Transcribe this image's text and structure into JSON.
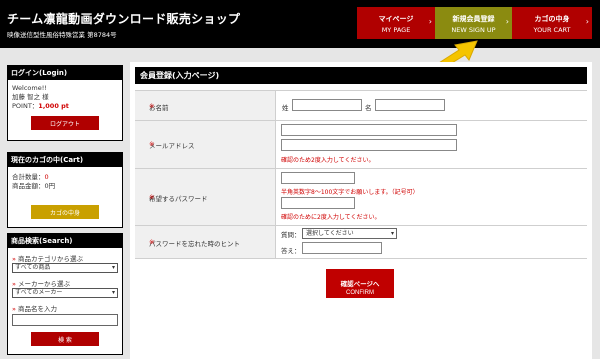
{
  "header": {
    "title": "チーム凛龍動画ダウンロード販売ショップ",
    "subtitle": "映像送信型性風俗特殊営業 第8784号",
    "nav": [
      {
        "label": "マイページ",
        "sub": "MY PAGE"
      },
      {
        "label": "新規会員登録",
        "sub": "NEW SIGN UP"
      },
      {
        "label": "カゴの中身",
        "sub": "YOUR CART"
      }
    ],
    "chevron": "›"
  },
  "sidebar": {
    "login": {
      "heading": "ログイン(Login)",
      "welcome": "Welcome!!",
      "user_name": "加藤 智之 様",
      "point_label": "POINT：",
      "point_value": "1,000 pt",
      "logout_button": "ログアウト"
    },
    "cart": {
      "heading": "現在のカゴの中(Cart)",
      "count_label": "合計数量：",
      "count_value": "0",
      "total_label": "商品金額：",
      "total_value": "0円",
      "cart_button": "カゴの中身"
    },
    "search": {
      "heading": "商品検索(Search)",
      "marker": "»",
      "category_label": "商品カテゴリから選ぶ",
      "category_value": "すべての商品",
      "maker_label": "メーカーから選ぶ",
      "maker_value": "すべてのメーカー",
      "name_label": "商品名を入力",
      "search_button": "検 索"
    }
  },
  "main": {
    "title": "会員登録(入力ページ)",
    "rows": {
      "name": {
        "label": "お名前",
        "required": "※",
        "sei": "姓",
        "mei": "名"
      },
      "email": {
        "label": "メールアドレス",
        "required": "※",
        "note": "確認のため2度入力してください。"
      },
      "password": {
        "label": "希望するパスワード",
        "required": "※",
        "rule": "半角英数字8〜100文字でお願いします。（記号可）",
        "note": "確認のために2度入力してください。"
      },
      "hint": {
        "label": "パスワードを忘れた時のヒント",
        "required": "※",
        "question_label": "質問：",
        "question_value": "選択してください",
        "answer_label": "答え："
      }
    },
    "confirm": {
      "label": "確認ページへ",
      "sub": "CONFIRM"
    }
  },
  "colors": {
    "accent_red": "#b00000",
    "header_green": "#8b8b10",
    "cart_gold": "#c9a000",
    "arrow_yellow": "#f5c400"
  }
}
